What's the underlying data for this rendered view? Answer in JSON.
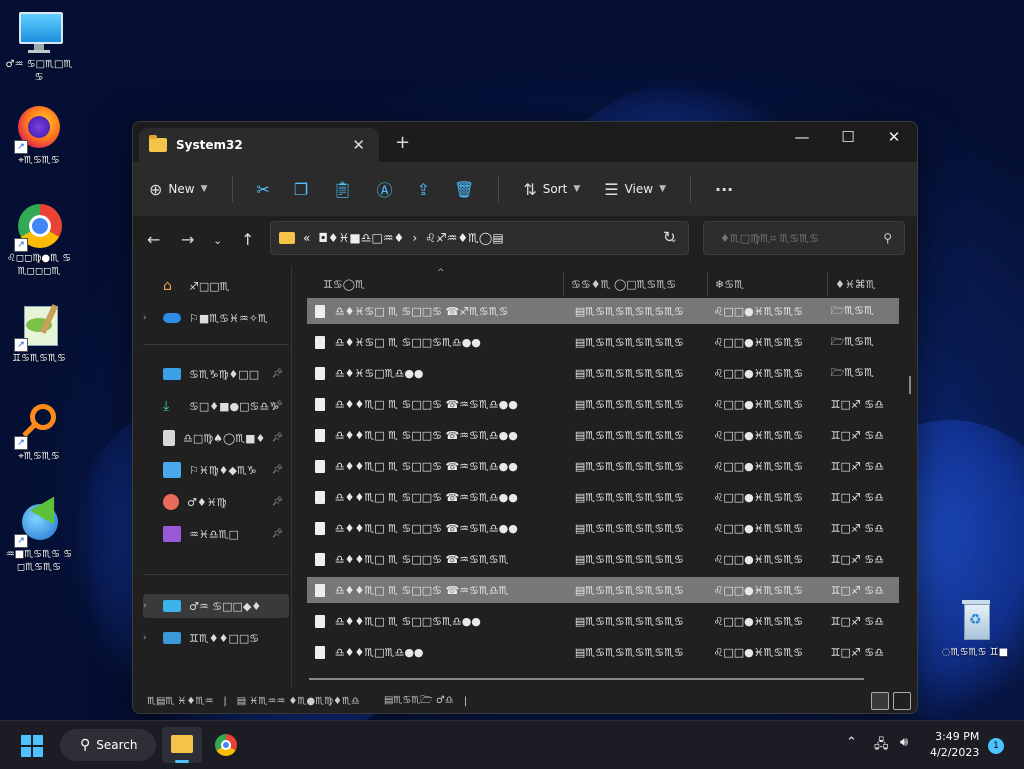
{
  "desktop_icons": [
    {
      "name": "this-pc",
      "label": "♂♒ ♋□♏□♏♋"
    },
    {
      "name": "firefox",
      "label": "⌖♏♋♏♋"
    },
    {
      "name": "chrome",
      "label": "♌◻◻♍●♏ ♋♏◻◻◻♏"
    },
    {
      "name": "notepadpp",
      "label": "♊♋♏♋♏♋"
    },
    {
      "name": "search-tool",
      "label": "⌖♏♋♏♋"
    },
    {
      "name": "idm",
      "label": "♒■♏♋♏♋ ♋◻♏♋♏♋"
    },
    {
      "name": "recycle-bin",
      "label": "◌♏♋♏♋ ♊■"
    }
  ],
  "explorer": {
    "tab_title": "System32",
    "new_tab": "+",
    "toolbar": {
      "new_label": "New",
      "sort_label": "Sort",
      "view_label": "View",
      "more_label": "···"
    },
    "address": {
      "prefix": "«",
      "crumb1": "◘♦♓■♎□♒♦",
      "crumb2": "♌♐♒♦♏◯▤"
    },
    "search_placeholder": "♦♏□♍♏⌗ ♏♋♏♋",
    "nav": {
      "home": "♐□□♏",
      "onedrive": "⚐■♏♋♓♒✧♏",
      "desktop": "♋♏♑♍♦□□",
      "downloads": "♋□♦■●□♋♎♑",
      "documents": "♎□♍♠◯♏■♦",
      "pictures": "⚐♓♍♦◆♏♑",
      "music": "♂♦♓♍",
      "videos": "♒♓♎♏□",
      "this_pc": "♂♒ ♋□□◆♦",
      "network": "♊♏♦♦□□♋"
    },
    "columns": [
      "♊♋◯♏",
      "♋♋♦♏ ◯□♏♋♏♋",
      "❄♋♏",
      "♦♓⌘♏"
    ],
    "rows": [
      {
        "name": "♎♦♓♋□ ♏ ♋□□♋ ☎♐♏♋♏♋",
        "date": "▤♏♋♏♋♏♋♏♋♏♋",
        "type": "♌□□●♓♏♋♏♋",
        "size": "🗁♏♋♏",
        "sel": true
      },
      {
        "name": "♎♦♓♋□ ♏ ♋□□♋♏♎●●",
        "date": "▤♏♋♏♋♏♋♏♋♏♋",
        "type": "♌□□●♓♏♋♏♋",
        "size": "🗁♏♋♏",
        "sel": false
      },
      {
        "name": "♎♦♓♋□♏♎●●",
        "date": "▤♏♋♏♋♏♋♏♋♏♋",
        "type": "♌□□●♓♏♋♏♋",
        "size": "🗁♏♋♏",
        "sel": false
      },
      {
        "name": "♎♦♦♏□ ♏ ♋□□♋ ☎♒♋♏♎●●",
        "date": "▤♏♋♏♋♏♋♏♋♏♋",
        "type": "♌□□●♓♏♋♏♋",
        "size": "♊□♐ ♋♎",
        "sel": false
      },
      {
        "name": "♎♦♦♏□ ♏ ♋□□♋ ☎♒♋♏♎●●",
        "date": "▤♏♋♏♋♏♋♏♋♏♋",
        "type": "♌□□●♓♏♋♏♋",
        "size": "♊□♐ ♋♎",
        "sel": false
      },
      {
        "name": "♎♦♦♏□ ♏ ♋□□♋ ☎♒♋♏♎●●",
        "date": "▤♏♋♏♋♏♋♏♋♏♋",
        "type": "♌□□●♓♏♋♏♋",
        "size": "♊□♐ ♋♎",
        "sel": false
      },
      {
        "name": "♎♦♦♏□ ♏ ♋□□♋ ☎♒♋♏♎●●",
        "date": "▤♏♋♏♋♏♋♏♋♏♋",
        "type": "♌□□●♓♏♋♏♋",
        "size": "♊□♐ ♋♎",
        "sel": false
      },
      {
        "name": "♎♦♦♏□ ♏ ♋□□♋ ☎♒♋♏♎●●",
        "date": "▤♏♋♏♋♏♋♏♋♏♋",
        "type": "♌□□●♓♏♋♏♋",
        "size": "♊□♐ ♋♎",
        "sel": false
      },
      {
        "name": "♎♦♦♏□ ♏ ♋□□♋ ☎♒♋♏♋♏",
        "date": "▤♏♋♏♋♏♋♏♋♏♋",
        "type": "♌□□●♓♏♋♏♋",
        "size": "♊□♐ ♋♎",
        "sel": false
      },
      {
        "name": "♎♦♦♏□ ♏ ♋□□♋ ☎♒♋♏♎♏",
        "date": "▤♏♋♏♋♏♋♏♋♏♋",
        "type": "♌□□●♓♏♋♏♋",
        "size": "♊□♐ ♋♎",
        "sel": true
      },
      {
        "name": "♎♦♦♏□ ♏ ♋□□♋♏♎●●",
        "date": "▤♏♋♏♋♏♋♏♋♏♋",
        "type": "♌□□●♓♏♋♏♋",
        "size": "♊□♐ ♋♎",
        "sel": false
      },
      {
        "name": "♎♦♦♏□♏♎●●",
        "date": "▤♏♋♏♋♏♋♏♋♏♋",
        "type": "♌□□●♓♏♋♏♋",
        "size": "♊□♐ ♋♎",
        "sel": false
      }
    ],
    "status": {
      "count": "♏▤♏ ♓♦♏♒",
      "selected": "▤ ♓♏♒♒ ♦♏●♏♍♦♏♎",
      "size": "▤♏♋♏🗁 ♂♎"
    }
  },
  "taskbar": {
    "search_label": "Search",
    "time": "3:49 PM",
    "date": "4/2/2023",
    "notification_count": "1"
  }
}
